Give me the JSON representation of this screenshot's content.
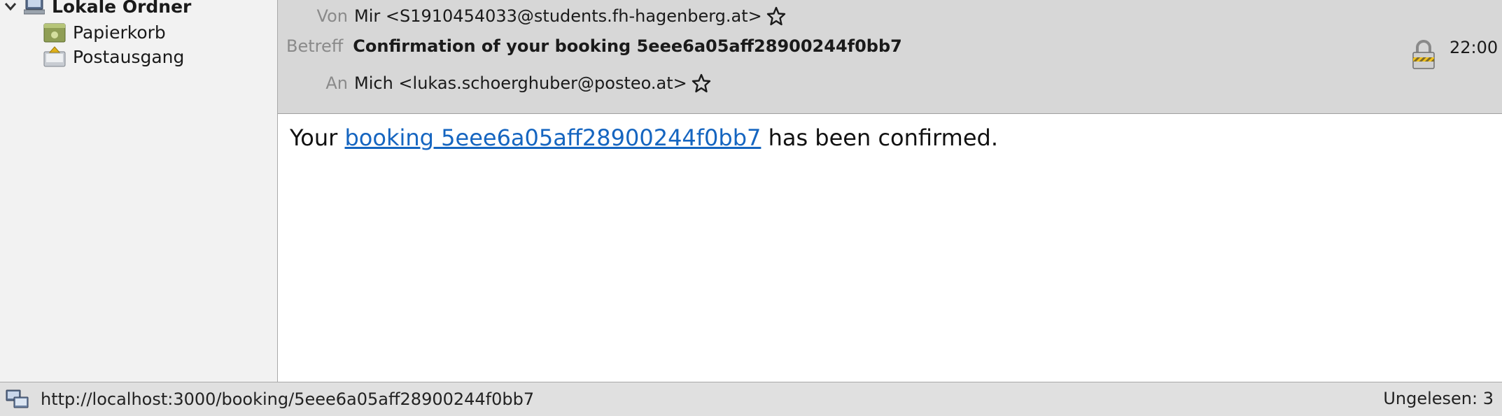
{
  "sidebar": {
    "root": {
      "label": "Lokale Ordner",
      "icon": "computer-icon"
    },
    "folders": [
      {
        "label": "Papierkorb",
        "icon": "trash-folder-icon"
      },
      {
        "label": "Postausgang",
        "icon": "outbox-folder-icon"
      }
    ]
  },
  "header": {
    "from_label": "Von",
    "from_value": "Mir <S1910454033@students.fh-hagenberg.at>",
    "subject_label": "Betreff",
    "subject_value": "Confirmation of your booking 5eee6a05aff28900244f0bb7",
    "to_label": "An",
    "to_value": "Mich <lukas.schoerghuber@posteo.at>",
    "date": "22:00"
  },
  "message": {
    "prefix": "Your ",
    "link_text": "booking 5eee6a05aff28900244f0bb7",
    "suffix": " has been confirmed."
  },
  "statusbar": {
    "url": "http://localhost:3000/booking/5eee6a05aff28900244f0bb7",
    "unread": "Ungelesen: 3"
  },
  "colors": {
    "link": "#1565c0",
    "header_bg": "#d7d7d7",
    "sidebar_bg": "#f2f2f2",
    "statusbar_bg": "#e0e0e0"
  }
}
